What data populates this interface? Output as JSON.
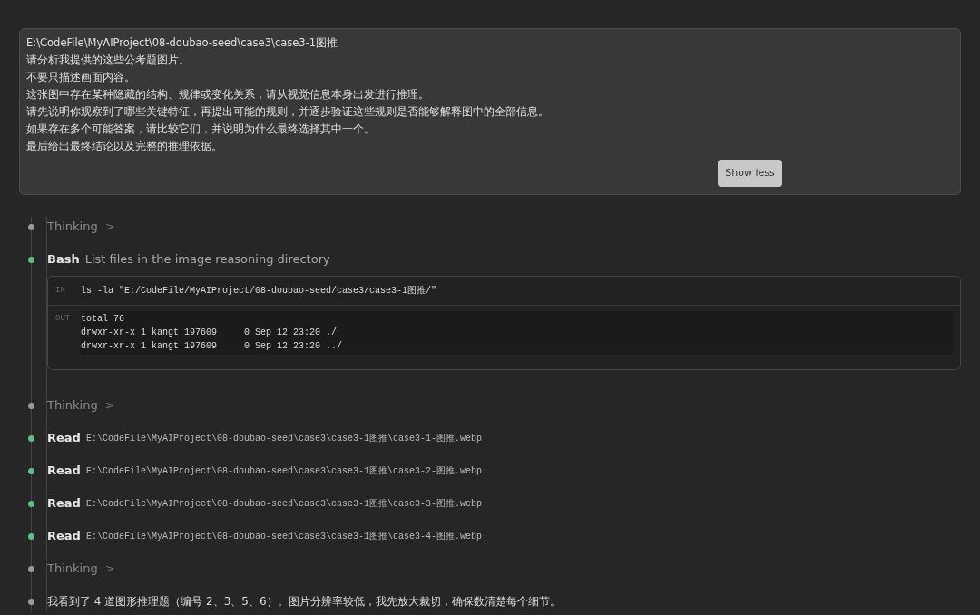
{
  "prompt": {
    "lines": [
      "E:\\CodeFile\\MyAIProject\\08-doubao-seed\\case3\\case3-1图推",
      "请分析我提供的这些公考题图片。",
      "不要只描述画面内容。",
      "这张图中存在某种隐藏的结构、规律或变化关系，请从视觉信息本身出发进行推理。",
      "请先说明你观察到了哪些关键特征，再提出可能的规则，并逐步验证这些规则是否能够解释图中的全部信息。",
      "如果存在多个可能答案，请比较它们，并说明为什么最终选择其中一个。",
      "最后给出最终结论以及完整的推理依据。"
    ],
    "button": "Show less"
  },
  "steps": [
    {
      "kind": "thinking",
      "color": "#9a9a9a",
      "label": "Thinking",
      "chevron": ">"
    },
    {
      "kind": "tool",
      "color": "#5fbf7f",
      "label": "Bash",
      "description": "List files in the image reasoning directory",
      "in_label": "IN",
      "command": "ls -la \"E:/CodeFile/MyAIProject/08-doubao-seed/case3/case3-1图推/\"",
      "out_label": "OUT",
      "output": [
        "total 76",
        "drwxr-xr-x 1 kangt 197609     0 Sep 12 23:20 ./",
        "drwxr-xr-x 1 kangt 197609     0 Sep 12 23:20 ../"
      ]
    },
    {
      "kind": "thinking",
      "color": "#9a9a9a",
      "label": "Thinking",
      "chevron": ">"
    },
    {
      "kind": "read",
      "color": "#5fbf7f",
      "label": "Read",
      "path": "E:\\CodeFile\\MyAIProject\\08-doubao-seed\\case3\\case3-1图推\\case3-1-图推.webp"
    },
    {
      "kind": "read",
      "color": "#5fbf7f",
      "label": "Read",
      "path": "E:\\CodeFile\\MyAIProject\\08-doubao-seed\\case3\\case3-1图推\\case3-2-图推.webp"
    },
    {
      "kind": "read",
      "color": "#5fbf7f",
      "label": "Read",
      "path": "E:\\CodeFile\\MyAIProject\\08-doubao-seed\\case3\\case3-1图推\\case3-3-图推.webp"
    },
    {
      "kind": "read",
      "color": "#5fbf7f",
      "label": "Read",
      "path": "E:\\CodeFile\\MyAIProject\\08-doubao-seed\\case3\\case3-1图推\\case3-4-图推.webp"
    },
    {
      "kind": "thinking",
      "color": "#9a9a9a",
      "label": "Thinking",
      "chevron": ">"
    },
    {
      "kind": "message",
      "color": "#9a9a9a",
      "text": "我看到了 4 道图形推理题（编号 2、3、5、6）。图片分辨率较低，我先放大裁切，确保数清楚每个细节。"
    }
  ]
}
